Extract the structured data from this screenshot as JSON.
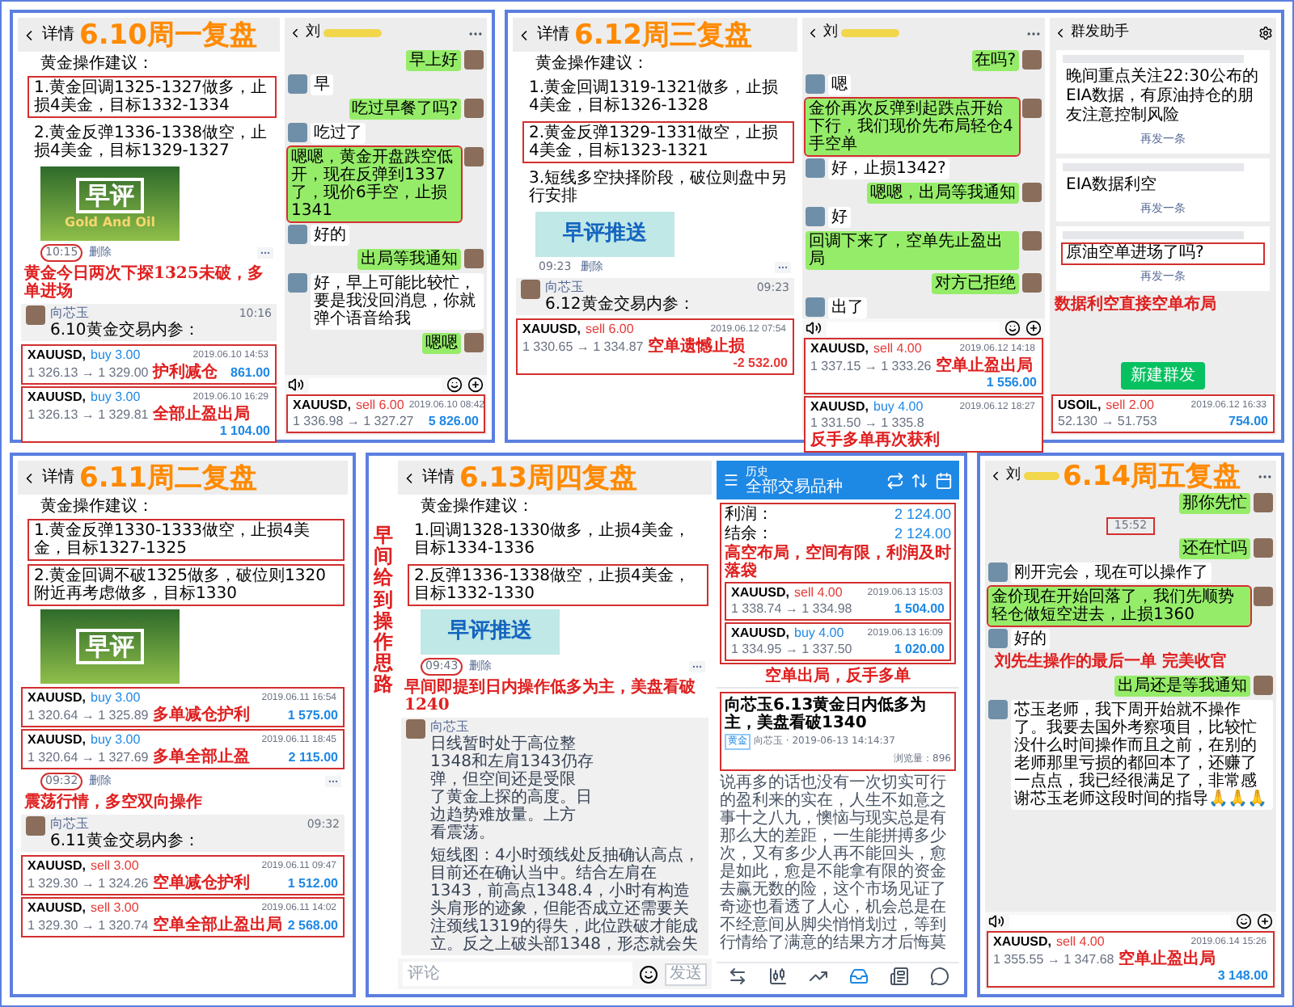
{
  "panels": [
    {
      "title": "6.10周一复盘",
      "screens": [
        {
          "kind": "detail",
          "header": "详情",
          "blocks": [
            {
              "kind": "heading",
              "text": "黄金操作建议："
            },
            {
              "kind": "suggestion",
              "text": "1.黄金回调1325-1327做多，止损4美金，目标1332-1334",
              "highlighted": true
            },
            {
              "kind": "suggestion",
              "text": "2.黄金反弹1336-1338做空，止损4美金，目标1329-1327",
              "highlighted": false
            },
            {
              "kind": "photo_banner",
              "title": "早评",
              "subtitle": "Gold And Oil"
            },
            {
              "kind": "meta",
              "time": "10:15",
              "action": "删除",
              "highlighted": true
            },
            {
              "kind": "note",
              "text": "黄金今日两次下探1325未破，多单进场"
            },
            {
              "kind": "comment",
              "name": "向芯玉",
              "time": "10:16",
              "text": "6.10黄金交易内参："
            },
            {
              "kind": "trades",
              "trades": [
                {
                  "symbol": "XAUUSD,",
                  "order": "buy 3.00",
                  "kind": "buy",
                  "prices": "1 326.13 → 1 329.00",
                  "date": "2019.06.10 14:53",
                  "profit": "861.00",
                  "loss": false,
                  "note": "护利减仓"
                },
                {
                  "symbol": "XAUUSD,",
                  "order": "buy 3.00",
                  "kind": "buy",
                  "prices": "1 326.13 → 1 329.81",
                  "date": "2019.06.10 16:29",
                  "profit": "1 104.00",
                  "loss": false,
                  "note": "全部止盈出局"
                }
              ]
            }
          ]
        },
        {
          "kind": "chat",
          "name": "刘",
          "messages": [
            {
              "kind": "out",
              "text": "早上好",
              "highlighted": false
            },
            {
              "kind": "in",
              "text": "早",
              "highlighted": false
            },
            {
              "kind": "out",
              "text": "吃过早餐了吗?",
              "highlighted": false
            },
            {
              "kind": "in",
              "text": "吃过了",
              "highlighted": false
            },
            {
              "kind": "out",
              "text": "嗯嗯，黄金开盘跌空低开，现在反弹到1337了，现价6手空，止损1341",
              "highlighted": true
            },
            {
              "kind": "in",
              "text": "好的",
              "highlighted": false
            },
            {
              "kind": "out",
              "text": "出局等我通知",
              "highlighted": false
            },
            {
              "kind": "in",
              "text": "好，早上可能比较忙，要是我没回消息，你就弹个语音给我",
              "highlighted": false
            },
            {
              "kind": "out",
              "text": "嗯嗯",
              "highlighted": false
            }
          ],
          "trades": [
            {
              "symbol": "XAUUSD,",
              "order": "sell 6.00",
              "kind": "sell",
              "prices": "1 336.98 → 1 327.27",
              "date": "2019.06.10 08:42",
              "profit": "5 826.00",
              "loss": false
            }
          ]
        }
      ]
    },
    {
      "title": "6.12周三复盘",
      "screens": [
        {
          "kind": "detail",
          "header": "详情",
          "blocks": [
            {
              "kind": "heading",
              "text": "黄金操作建议："
            },
            {
              "kind": "suggestion",
              "text": "1.黄金回调1319-1321做多，止损4美金，目标1326-1328",
              "highlighted": false
            },
            {
              "kind": "suggestion",
              "text": "2.黄金反弹1329-1331做空，止损4美金，目标1323-1321",
              "highlighted": true
            },
            {
              "kind": "suggestion",
              "text": "3.短线多空抉择阶段，破位则盘中另行安排",
              "highlighted": false
            },
            {
              "kind": "flat_banner",
              "title": "早评推送"
            },
            {
              "kind": "meta",
              "time": "09:23",
              "action": "删除",
              "highlighted": false
            },
            {
              "kind": "comment",
              "name": "向芯玉",
              "time": "09:23",
              "text": "6.12黄金交易内参："
            },
            {
              "kind": "trades",
              "trades": [
                {
                  "symbol": "XAUUSD,",
                  "order": "sell 6.00",
                  "kind": "sell",
                  "prices": "1 330.65 → 1 334.87",
                  "date": "2019.06.12 07:54",
                  "profit": "-2 532.00",
                  "loss": true,
                  "note": "空单遗憾止损"
                }
              ]
            }
          ]
        },
        {
          "kind": "chat",
          "name": "刘",
          "messages": [
            {
              "kind": "out",
              "text": "在吗?",
              "highlighted": false
            },
            {
              "kind": "in",
              "text": "嗯",
              "highlighted": false
            },
            {
              "kind": "out",
              "text": "金价再次反弹到起跌点开始下行，我们现价先布局轻仓4手空单",
              "highlighted": true
            },
            {
              "kind": "in",
              "text": "好，止损1342?",
              "highlighted": false
            },
            {
              "kind": "out",
              "text": "嗯嗯，出局等我通知",
              "highlighted": false
            },
            {
              "kind": "in",
              "text": "好",
              "highlighted": false
            },
            {
              "kind": "out",
              "text": "回调下来了，空单先止盈出局",
              "highlighted": false
            },
            {
              "kind": "out",
              "text": "对方已拒绝",
              "highlighted": false
            },
            {
              "kind": "in",
              "text": "出了",
              "highlighted": false
            }
          ],
          "trades": [
            {
              "symbol": "XAUUSD,",
              "order": "sell 4.00",
              "kind": "sell",
              "prices": "1 337.15 → 1 333.26",
              "date": "2019.06.12 14:18",
              "profit": "1 556.00",
              "loss": false,
              "note": "空单止盈出局"
            },
            {
              "symbol": "XAUUSD,",
              "order": "buy 4.00",
              "kind": "buy",
              "prices": "1 331.50 → 1 335.8",
              "date": "2019.06.12 18:27",
              "note": "反手多单再次获利"
            }
          ]
        },
        {
          "kind": "broadcast",
          "header": "群发助手",
          "cards": [
            {
              "text": "晚间重点关注22:30公布的EIA数据，有原油持仓的朋友注意控制风险",
              "action": "再发一条",
              "highlighted": false
            },
            {
              "text": "EIA数据利空",
              "action": "再发一条",
              "highlighted": false
            },
            {
              "text": "原油空单进场了吗?",
              "action": "再发一条",
              "highlighted": true
            }
          ],
          "note": "数据利空直接空单布局",
          "button": "新建群发",
          "trades": [
            {
              "symbol": "USOIL,",
              "order": "sell 2.00",
              "kind": "sell",
              "prices": "52.130 → 51.753",
              "date": "2019.06.12 16:33",
              "profit": "754.00",
              "loss": false
            }
          ]
        }
      ]
    },
    {
      "title": "6.11周二复盘",
      "screens": [
        {
          "kind": "detail",
          "header": "详情",
          "blocks": [
            {
              "kind": "heading",
              "text": "黄金操作建议："
            },
            {
              "kind": "suggestion",
              "text": "1.黄金反弹1330-1333做空，止损4美金，目标1327-1325",
              "highlighted": true
            },
            {
              "kind": "suggestion",
              "text": "2.黄金回调不破1325做多，破位则1320附近再考虑做多，目标1330",
              "highlighted": true
            },
            {
              "kind": "photo_banner",
              "title": "早评"
            },
            {
              "kind": "trades",
              "trades": [
                {
                  "symbol": "XAUUSD,",
                  "order": "buy 3.00",
                  "kind": "buy",
                  "prices": "1 320.64 → 1 325.89",
                  "date": "2019.06.11 16:54",
                  "profit": "1 575.00",
                  "loss": false,
                  "note": "多单减仓护利"
                },
                {
                  "symbol": "XAUUSD,",
                  "order": "buy 3.00",
                  "kind": "buy",
                  "prices": "1 320.64 → 1 327.69",
                  "date": "2019.06.11 18:45",
                  "profit": "2 115.00",
                  "loss": false,
                  "note": "多单全部止盈"
                }
              ]
            },
            {
              "kind": "meta",
              "time": "09:32",
              "action": "删除",
              "highlighted": true
            },
            {
              "kind": "note",
              "text": "震荡行情，多空双向操作"
            },
            {
              "kind": "comment",
              "name": "向芯玉",
              "time": "09:32",
              "text": "6.11黄金交易内参："
            },
            {
              "kind": "trades",
              "trades": [
                {
                  "symbol": "XAUUSD,",
                  "order": "sell 3.00",
                  "kind": "sell",
                  "prices": "1 329.30 → 1 324.26",
                  "date": "2019.06.11 09:47",
                  "profit": "1 512.00",
                  "loss": false,
                  "note": "空单减仓护利"
                },
                {
                  "symbol": "XAUUSD,",
                  "order": "sell 3.00",
                  "kind": "sell",
                  "prices": "1 329.30 → 1 320.74",
                  "date": "2019.06.11 14:02",
                  "profit": "2 568.00",
                  "loss": false,
                  "note": "空单全部止盈出局"
                }
              ]
            }
          ]
        }
      ]
    },
    {
      "title": "6.13周四复盘",
      "side_note": "早间给到操作思路",
      "screens": [
        {
          "kind": "detail",
          "header": "详情",
          "blocks": [
            {
              "kind": "heading",
              "text": "黄金操作建议："
            },
            {
              "kind": "suggestion",
              "text": "1.回调1328-1330做多，止损4美金，目标1334-1336",
              "highlighted": false
            },
            {
              "kind": "suggestion",
              "text": "2.反弹1336-1338做空，止损4美金，目标1332-1330",
              "highlighted": true
            },
            {
              "kind": "flat_banner",
              "title": "早评推送"
            },
            {
              "kind": "meta",
              "time": "09:43",
              "action": "删除",
              "highlighted": true
            },
            {
              "kind": "note",
              "text": "早间即提到日内操作低多为主，美盘看破1240"
            },
            {
              "kind": "comment",
              "name": "向芯玉",
              "lines": [
                "日线暂时处于高位整",
                "1348和左肩1343仍存",
                "弹，但空间还是受限",
                "了黄金上探的高度。日",
                "边趋势难放量。上方",
                "看震荡。"
              ],
              "paragraph": "短线图：4小时颈线处反抽确认高点，目前还在确认当中。结合左肩在1343，前高点1348.4，小时有构造头肩形的迹象，但能否成立还需要关注颈线1319的得失，此位跌破才能成立。反之上破头部1348，形态就会失"
            },
            {
              "kind": "input",
              "placeholder": "评论",
              "button": "发送"
            }
          ]
        },
        {
          "kind": "history",
          "header": "历史",
          "subheader": "全部交易品种",
          "summary": [
            {
              "label": "利润：",
              "value": "2 124.00"
            },
            {
              "label": "结余：",
              "value": "2 124.00"
            }
          ],
          "note": "高空布局，空间有限，利润及时落袋",
          "after_note": "空单出局，反手多单",
          "trades": [
            {
              "symbol": "XAUUSD,",
              "order": "sell 4.00",
              "kind": "sell",
              "prices": "1 338.74 → 1 334.98",
              "date": "2019.06.13 15:03",
              "profit": "1 504.00",
              "loss": false
            },
            {
              "symbol": "XAUUSD,",
              "order": "buy 4.00",
              "kind": "buy",
              "prices": "1 334.95 → 1 337.50",
              "date": "2019.06.13 16:09",
              "profit": "1 020.00",
              "loss": false
            }
          ],
          "nav": [
            {
              "selected": false
            },
            {
              "selected": false
            },
            {
              "selected": false
            },
            {
              "selected": true
            },
            {
              "selected": false
            },
            {
              "selected": false
            }
          ]
        }
      ],
      "article": {
        "title": "向芯玉6.13黄金日内低多为主，美盘看破1340",
        "tag": "黄金",
        "author": "向芯玉 · 2019-06-13 14:14:37",
        "views": "浏览量：896",
        "body": "说再多的话也没有一次切实可行的盈利来的实在，人生不如意之事十之八九，懊恼与现实总是有那么大的差距，一生能拼搏多少次，又有多少人再不能回头，愈是如此，愈是不能拿有限的资金去赢无数的险，这个市场见证了奇迹也看透了人心，机会总是在不经意间从脚尖悄悄划过，等到行情给了满意的结果方才后悔莫"
      }
    },
    {
      "title": "6.14周五复盘",
      "screens": [
        {
          "kind": "chat",
          "name": "刘",
          "messages": [
            {
              "kind": "out",
              "text": "那你先忙",
              "highlighted": false
            },
            {
              "kind": "time",
              "text": "15:52",
              "highlighted": true
            },
            {
              "kind": "out",
              "text": "还在忙吗",
              "highlighted": false
            },
            {
              "kind": "in",
              "text": "刚开完会，现在可以操作了",
              "highlighted": false
            },
            {
              "kind": "out",
              "text": "金价现在开始回落了，我们先顺势轻仓做短空进去，止损1360",
              "highlighted": true
            },
            {
              "kind": "in",
              "text": "好的",
              "highlighted": false
            },
            {
              "kind": "note",
              "text": "刘先生操作的最后一单 完美收官"
            },
            {
              "kind": "out",
              "text": "出局还是等我通知",
              "highlighted": false
            },
            {
              "kind": "in",
              "text": "芯玉老师，我下周开始就不操作了。我要去国外考察项目，比较忙没什么时间操作而且之前，在别的老师那里亏损的都回本了，还赚了一点点，我已经很满足了，非常感谢芯玉老师这段时间的指导🙏🙏🙏",
              "highlighted": false
            }
          ],
          "trades": [
            {
              "symbol": "XAUUSD,",
              "order": "sell 4.00",
              "kind": "sell",
              "prices": "1 355.55 → 1 347.68",
              "date": "2019.06.14 15:26",
              "profit": "3 148.00",
              "loss": false,
              "note": "空单止盈出局"
            }
          ]
        }
      ]
    }
  ]
}
